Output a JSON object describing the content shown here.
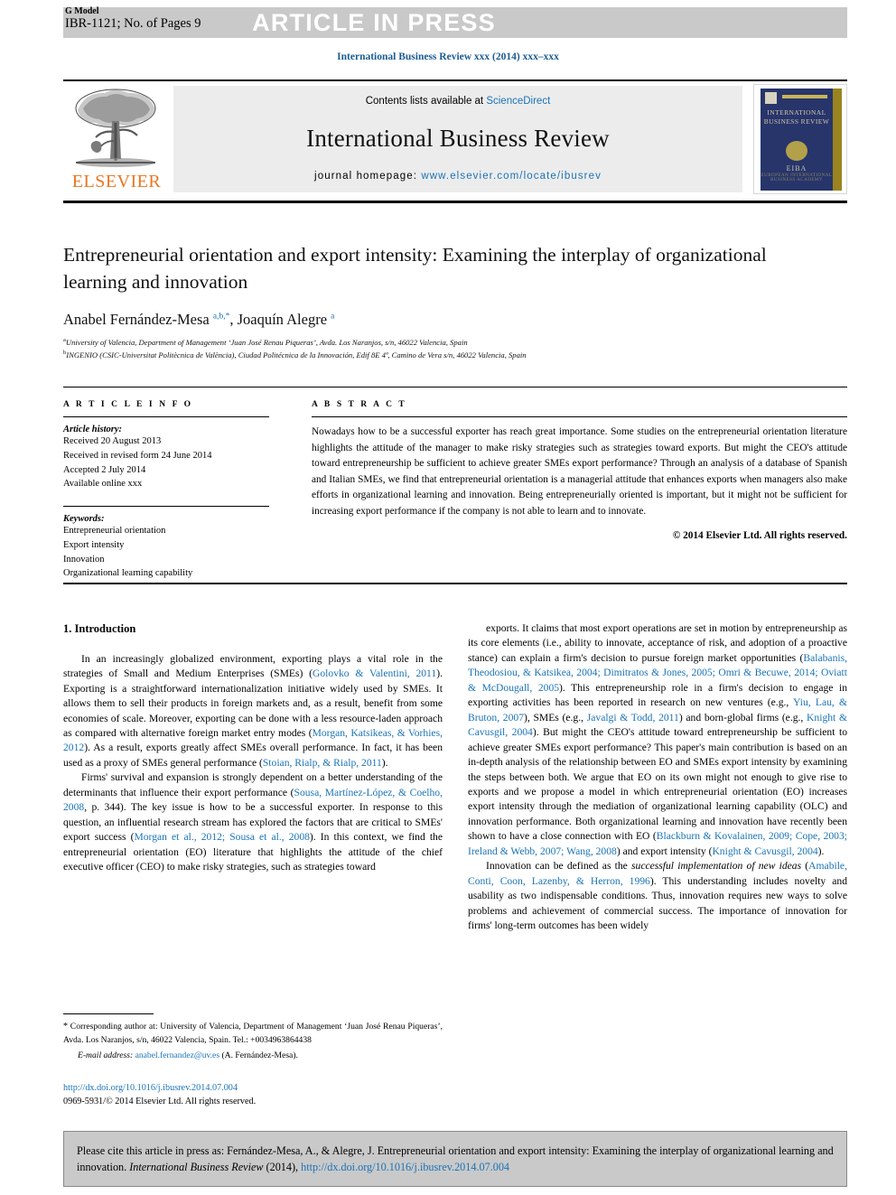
{
  "header": {
    "g_model": "G Model",
    "manuscript_id": "IBR-1121; No. of Pages 9",
    "press_banner": "ARTICLE IN PRESS",
    "running_head": "International Business Review xxx (2014) xxx–xxx"
  },
  "masthead": {
    "publisher_name": "ELSEVIER",
    "contents_prefix": "Contents lists available at ",
    "contents_link": "ScienceDirect",
    "journal_name": "International Business Review",
    "homepage_label": "journal homepage:",
    "homepage_url": "www.elsevier.com/locate/ibusrev",
    "cover": {
      "title": "INTERNATIONAL BUSINESS REVIEW",
      "society": "EIBA",
      "society_sub": "EUROPEAN INTERNATIONAL BUSINESS ACADEMY"
    }
  },
  "article": {
    "title": "Entrepreneurial orientation and export intensity: Examining the interplay of organizational learning and innovation",
    "authors_html": "Anabel Fernández-Mesa <sup>a,b,*</sup>, Joaquín Alegre <sup>a</sup>",
    "affiliations": [
      {
        "marker": "a",
        "text": "University of Valencia, Department of Management ‘Juan José Renau Piqueras’, Avda. Los Naranjos, s/n, 46022 Valencia, Spain"
      },
      {
        "marker": "b",
        "text": "INGENIO (CSIC-Universitat Politècnica de València), Ciudad Politécnica de la Innovación, Edif 8E 4ª, Camino de Vera s/n, 46022 Valencia, Spain"
      }
    ]
  },
  "article_info": {
    "label": "A R T I C L E  I N F O",
    "history_head": "Article history:",
    "history": [
      "Received 20 August 2013",
      "Received in revised form 24 June 2014",
      "Accepted 2 July 2014",
      "Available online xxx"
    ],
    "keywords_head": "Keywords:",
    "keywords": [
      "Entrepreneurial orientation",
      "Export intensity",
      "Innovation",
      "Organizational learning capability"
    ]
  },
  "abstract": {
    "label": "A B S T R A C T",
    "text": "Nowadays how to be a successful exporter has reach great importance. Some studies on the entrepreneurial orientation literature highlights the attitude of the manager to make risky strategies such as strategies toward exports. But might the CEO's attitude toward entrepreneurship be sufficient to achieve greater SMEs export performance? Through an analysis of a database of Spanish and Italian SMEs, we find that entrepreneurial orientation is a managerial attitude that enhances exports when managers also make efforts in organizational learning and innovation. Being entrepreneurially oriented is important, but it might not be sufficient for increasing export performance if the company is not able to learn and to innovate.",
    "copyright": "© 2014 Elsevier Ltd. All rights reserved."
  },
  "body": {
    "section_heading": "1. Introduction",
    "left_paragraphs": [
      "In an increasingly globalized environment, exporting plays a vital role in the strategies of Small and Medium Enterprises (SMEs) (<span class=\"cite\">Golovko &amp; Valentini, 2011</span>). Exporting is a straightforward internationalization initiative widely used by SMEs. It allows them to sell their products in foreign markets and, as a result, benefit from some economies of scale. Moreover, exporting can be done with a less resource-laden approach as compared with alternative foreign market entry modes (<span class=\"cite\">Morgan, Katsikeas, &amp; Vorhies, 2012</span>). As a result, exports greatly affect SMEs overall performance. In fact, it has been used as a proxy of SMEs general performance (<span class=\"cite\">Stoian, Rialp, &amp; Rialp, 2011</span>).",
      "Firms' survival and expansion is strongly dependent on a better understanding of the determinants that influence their export performance (<span class=\"cite\">Sousa, Martínez-López, &amp; Coelho, 2008</span>, p. 344). The key issue is how to be a successful exporter. In response to this question, an influential research stream has explored the factors that are critical to SMEs' export success (<span class=\"cite\">Morgan et al., 2012; Sousa et al., 2008</span>). In this context, we find the entrepreneurial orientation (EO) literature that highlights the attitude of the chief executive officer (CEO) to make risky strategies, such as strategies toward"
    ],
    "right_paragraphs": [
      "exports. It claims that most export operations are set in motion by entrepreneurship as its core elements (i.e., ability to innovate, acceptance of risk, and adoption of a proactive stance) can explain a firm's decision to pursue foreign market opportunities (<span class=\"cite\">Balabanis, Theodosiou, &amp; Katsikea, 2004; Dimitratos &amp; Jones, 2005; Omri &amp; Becuwe, 2014; Oviatt &amp; McDougall, 2005</span>). This entrepreneurship role in a firm's decision to engage in exporting activities has been reported in research on new ventures (e.g., <span class=\"cite\">Yiu, Lau, &amp; Bruton, 2007</span>), SMEs (e.g., <span class=\"cite\">Javalgi &amp; Todd, 2011</span>) and born-global firms (e.g., <span class=\"cite\">Knight &amp; Cavusgil, 2004</span>). But might the CEO's attitude toward entrepreneurship be sufficient to achieve greater SMEs export performance? This paper's main contribution is based on an in-depth analysis of the relationship between EO and SMEs export intensity by examining the steps between both. We argue that EO on its own might not enough to give rise to exports and we propose a model in which entrepreneurial orientation (EO) increases export intensity through the mediation of organizational learning capability (OLC) and innovation performance. Both organizational learning and innovation have recently been shown to have a close connection with EO (<span class=\"cite\">Blackburn &amp; Kovalainen, 2009; Cope, 2003; Ireland &amp; Webb, 2007; Wang, 2008</span>) and export intensity (<span class=\"cite\">Knight &amp; Cavusgil, 2004</span>).",
      "Innovation can be defined as the <i>successful implementation of new ideas</i> (<span class=\"cite\">Amabile, Conti, Coon, Lazenby, &amp; Herron, 1996</span>). This understanding includes novelty and usability as two indispensable conditions. Thus, innovation requires new ways to solve problems and achievement of commercial success. The importance of innovation for firms' long-term outcomes has been widely"
    ]
  },
  "footnote": {
    "corresponding_html": "<span class=\"star\">*</span> Corresponding author at: University of Valencia, Department of Management ‘Juan José Renau Piqueras’, Avda. Los Naranjos, s/n, 46022 Valencia, Spain. Tel.: +0034963864438",
    "email_label": "E-mail address:",
    "email": "anabel.fernandez@uv.es",
    "email_owner": "(A. Fernández-Mesa).",
    "doi": "http://dx.doi.org/10.1016/j.ibusrev.2014.07.004",
    "issn_line": "0969-5931/© 2014 Elsevier Ltd. All rights reserved."
  },
  "cite_box": {
    "prefix": "Please cite this article in press as: Fernández-Mesa, A., & Alegre, J. Entrepreneurial orientation and export intensity: Examining the interplay of organizational learning and innovation.",
    "journal": "International Business Review",
    "year": "(2014),",
    "doi": "http://dx.doi.org/10.1016/j.ibusrev.2014.07.004"
  },
  "colors": {
    "link_blue": "#1a73b8",
    "elsevier_orange": "#e87722",
    "banner_gray": "#c9c9c9",
    "masthead_gray": "#ececec"
  }
}
